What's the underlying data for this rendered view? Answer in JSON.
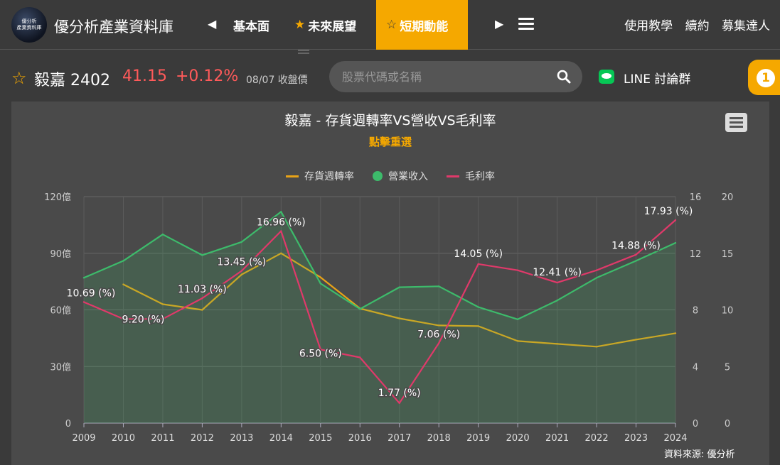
{
  "header": {
    "brand": "優分析產業資料庫",
    "logo_lines": [
      "優分析",
      "產業資料庫"
    ],
    "tabs": [
      {
        "label": "基本面",
        "star": false,
        "active": false
      },
      {
        "label": "未來展望",
        "star": true,
        "active": false
      },
      {
        "label": "短期動能",
        "star": true,
        "active": true
      }
    ],
    "links": [
      "使用教學",
      "續約",
      "募集達人"
    ]
  },
  "stock": {
    "name": "毅嘉 2402",
    "price": "41.15",
    "change": "+0.12%",
    "date": "08/07 收盤價"
  },
  "search": {
    "placeholder": "股票代碼或名稱"
  },
  "line_group": {
    "label": "LINE 討論群"
  },
  "notification": {
    "count": "1"
  },
  "colors": {
    "accent": "#f5a800",
    "inventory": "#e8a317",
    "revenue": "#3dbb6b",
    "margin": "#e0396a",
    "price_up": "#ff5a5a"
  },
  "chart_data": {
    "type": "line",
    "title": "毅嘉 - 存貨週轉率VS營收VS毛利率",
    "subtitle": "點擊重選",
    "source": "資料來源: 優分析",
    "x": [
      "2009",
      "2010",
      "2011",
      "2012",
      "2013",
      "2014",
      "2015",
      "2016",
      "2017",
      "2018",
      "2019",
      "2020",
      "2021",
      "2022",
      "2023",
      "2024"
    ],
    "series": [
      {
        "name": "存貨週轉率",
        "axis": "turnover",
        "color": "#e8a317",
        "type": "line",
        "values": [
          null,
          9.8,
          8.4,
          8.0,
          10.5,
          12.0,
          10.3,
          8.1,
          7.4,
          6.9,
          6.85,
          5.8,
          5.6,
          5.4,
          5.9,
          6.35
        ]
      },
      {
        "name": "營業收入",
        "axis": "revenue",
        "color": "#3dbb6b",
        "type": "area",
        "values": [
          77,
          86,
          100,
          89,
          96,
          112,
          74,
          60.5,
          72,
          72.5,
          61.5,
          55,
          65,
          77,
          86,
          95.5
        ]
      },
      {
        "name": "毛利率",
        "axis": "margin",
        "color": "#e0396a",
        "type": "line",
        "values": [
          10.69,
          9.2,
          9.2,
          11.03,
          13.45,
          16.96,
          6.5,
          5.8,
          1.77,
          7.06,
          14.05,
          13.5,
          12.41,
          13.5,
          14.88,
          17.93
        ]
      }
    ],
    "data_labels": [
      {
        "series": "毛利率",
        "index": 0,
        "text": "10.69 (%)"
      },
      {
        "series": "毛利率",
        "index": 1,
        "text": "9.20 (%)"
      },
      {
        "series": "毛利率",
        "index": 3,
        "text": "11.03 (%)"
      },
      {
        "series": "毛利率",
        "index": 4,
        "text": "13.45 (%)"
      },
      {
        "series": "毛利率",
        "index": 5,
        "text": "16.96 (%)"
      },
      {
        "series": "毛利率",
        "index": 6,
        "text": "6.50 (%)"
      },
      {
        "series": "毛利率",
        "index": 8,
        "text": "1.77 (%)"
      },
      {
        "series": "毛利率",
        "index": 9,
        "text": "7.06 (%)"
      },
      {
        "series": "毛利率",
        "index": 10,
        "text": "14.05 (%)"
      },
      {
        "series": "毛利率",
        "index": 12,
        "text": "12.41 (%)"
      },
      {
        "series": "毛利率",
        "index": 14,
        "text": "14.88 (%)"
      },
      {
        "series": "毛利率",
        "index": 15,
        "text": "17.93 (%)"
      }
    ],
    "axes": {
      "revenue": {
        "range": [
          0,
          120
        ],
        "ticks": [
          "0",
          "30億",
          "60億",
          "90億",
          "120億"
        ]
      },
      "turnover": {
        "range": [
          0,
          16
        ],
        "ticks": [
          "0",
          "4",
          "8",
          "12",
          "16"
        ]
      },
      "margin": {
        "range": [
          0,
          20
        ],
        "ticks": [
          "0",
          "5",
          "10",
          "15",
          "20"
        ]
      }
    },
    "grid": true,
    "legend_position": "top-center"
  }
}
